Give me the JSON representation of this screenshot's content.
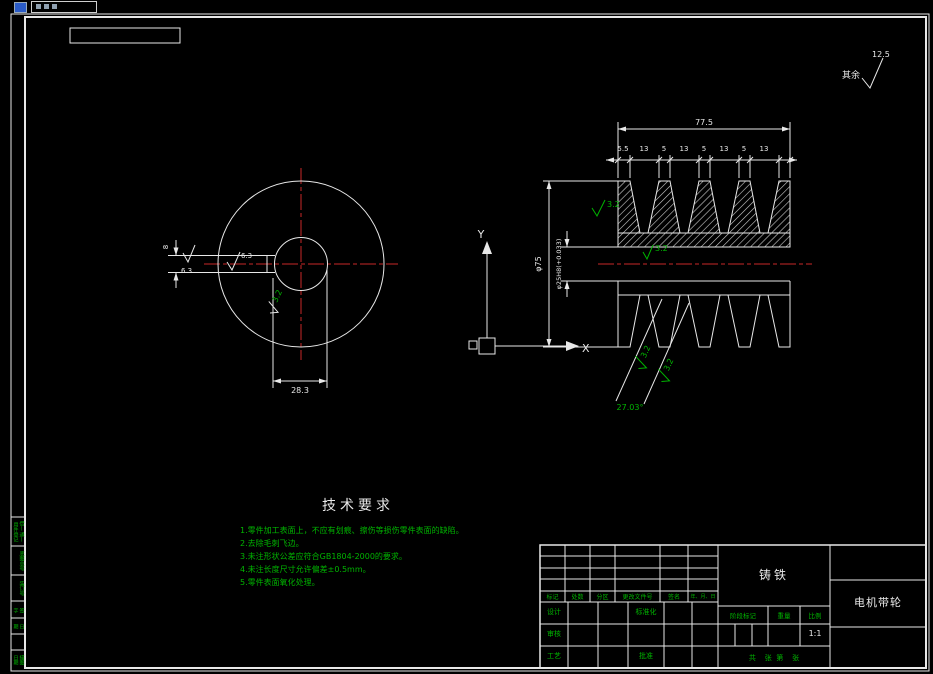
{
  "colors": {
    "background": "#000000",
    "line": "#e8e8e8",
    "centerline": "#c82828",
    "annotation": "#00b400"
  },
  "toolbar": {
    "app_icon": "cad-app-icon",
    "mini_toolbar": "docked-toolbar"
  },
  "sheet": {
    "side_column": [
      "借(通)用件登记",
      "底图总号",
      "装订号",
      "签 字",
      "日 期",
      "描图 日期"
    ]
  },
  "tech_requirements": {
    "title": "技术要求",
    "items": [
      "1.零件加工表面上，不应有划痕、擦伤等损伤零件表面的缺陷。",
      "2.去除毛刺飞边。",
      "3.未注形状公差应符合GB1804-2000的要求。",
      "4.未注长度尺寸允许偏差±0.5mm。",
      "5.零件表面氧化处理。"
    ]
  },
  "title_block": {
    "rev_header": [
      "标记",
      "处数",
      "分区",
      "更改文件号",
      "签名",
      "年、月、日"
    ],
    "design": "设计",
    "standardization": "标准化",
    "audit": "审核",
    "process": "工艺",
    "approve": "批准",
    "stage_mark": "阶段标记",
    "weight": "重量",
    "scale_label": "比例",
    "scale_value": "1:1",
    "material": "铸铁",
    "part_name": "电机带轮",
    "sheet_counter": "共    张  第    张"
  },
  "views": {
    "remark": {
      "label": "其余",
      "value": "12.5"
    },
    "front": {
      "keyway_width": "8",
      "keyway_dim": "28.3",
      "roughness_keyway": "6.3",
      "roughness_left": "6.3",
      "roughness_face": "3.2"
    },
    "section": {
      "overall_width": "77.5",
      "chain": [
        "5.5",
        "13",
        "5",
        "13",
        "5",
        "13",
        "5",
        "13"
      ],
      "outer_dia": "φ75",
      "bore_dia": "φ25H8(+0.033)",
      "groove_angle": "27.03°",
      "roughness_left": "3.2",
      "roughness_bore": "3.2",
      "roughness_groove_a": "3.2",
      "roughness_groove_b": "3.2"
    }
  },
  "ucs": {
    "x_label": "X",
    "y_label": "Y"
  }
}
